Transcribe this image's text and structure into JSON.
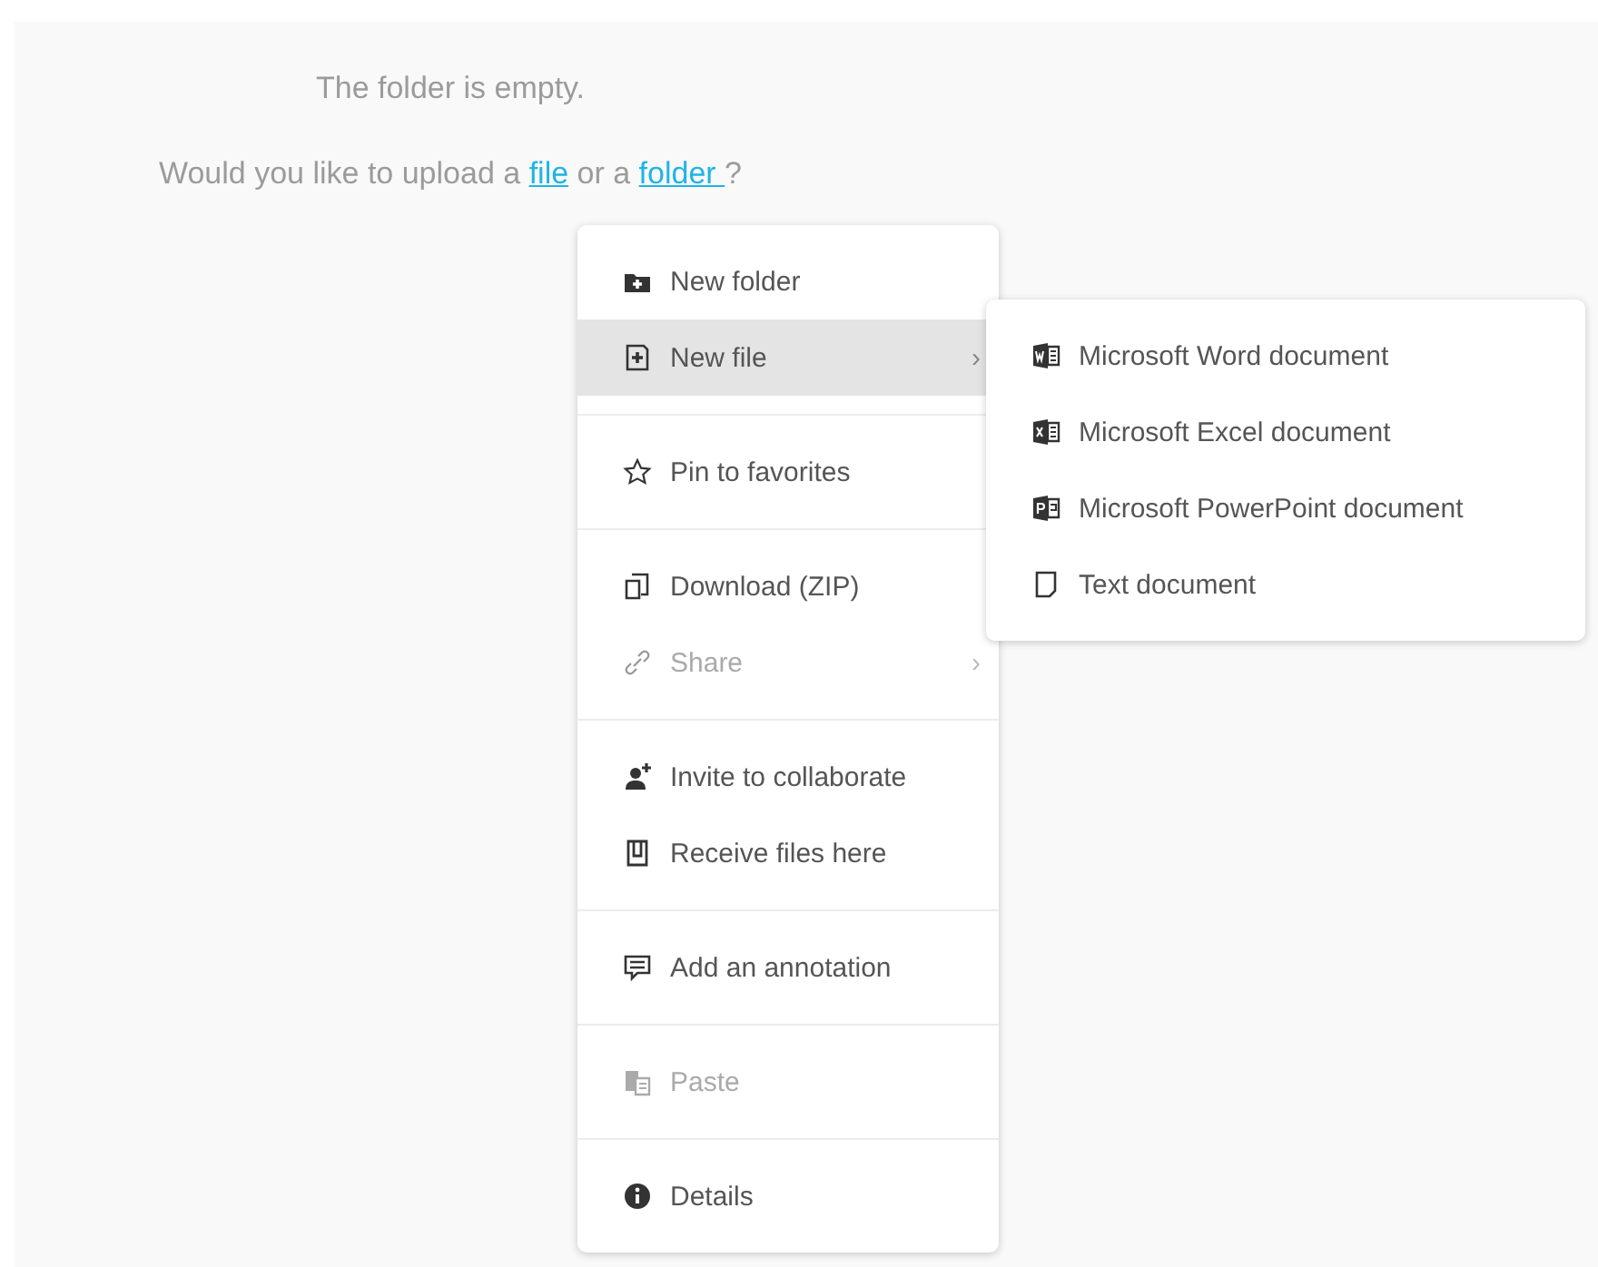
{
  "empty_state": {
    "title": "The folder is empty.",
    "prompt_before": "Would you like to upload a ",
    "file_link": "file",
    "prompt_middle": " or a ",
    "folder_link": "folder ",
    "prompt_end": "?"
  },
  "context_menu": {
    "groups": [
      {
        "items": [
          {
            "kind": "folder-plus",
            "label": "New folder",
            "selected": false,
            "disabled": false
          },
          {
            "kind": "file-plus",
            "label": "New file",
            "selected": true,
            "disabled": false,
            "caret": "›"
          }
        ]
      },
      {
        "items": [
          {
            "kind": "star",
            "label": "Pin to favorites",
            "selected": false,
            "disabled": false
          }
        ]
      },
      {
        "items": [
          {
            "kind": "download",
            "label": "Download (ZIP)",
            "selected": false,
            "disabled": false
          },
          {
            "kind": "link",
            "label": "Share",
            "selected": false,
            "disabled": true,
            "caret": "›"
          }
        ]
      },
      {
        "items": [
          {
            "kind": "person-plus",
            "label": "Invite to collaborate",
            "selected": false,
            "disabled": false
          },
          {
            "kind": "inbox",
            "label": "Receive files here",
            "selected": false,
            "disabled": false
          }
        ]
      },
      {
        "items": [
          {
            "kind": "comment",
            "label": "Add an annotation",
            "selected": false,
            "disabled": false
          }
        ]
      },
      {
        "items": [
          {
            "kind": "paste",
            "label": "Paste",
            "selected": false,
            "disabled": true
          }
        ]
      },
      {
        "items": [
          {
            "kind": "info",
            "label": "Details",
            "selected": false,
            "disabled": false
          }
        ]
      }
    ]
  },
  "submenu": {
    "items": [
      {
        "kind": "word",
        "label": "Microsoft Word document"
      },
      {
        "kind": "excel",
        "label": "Microsoft Excel document"
      },
      {
        "kind": "powerpoint",
        "label": "Microsoft PowerPoint document"
      },
      {
        "kind": "text",
        "label": "Text document"
      }
    ]
  }
}
